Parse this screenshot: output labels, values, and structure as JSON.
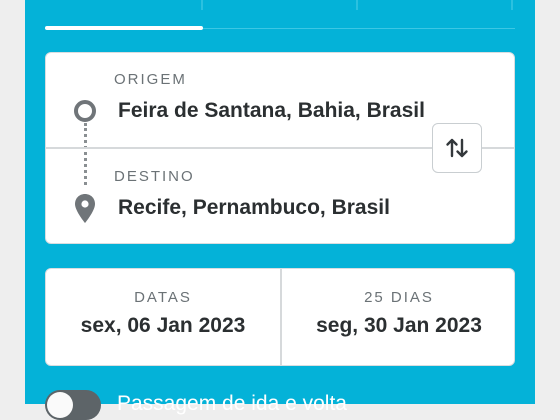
{
  "route": {
    "origin_label": "ORIGEM",
    "origin_value": "Feira de Santana, Bahia, Brasil",
    "destination_label": "DESTINO",
    "destination_value": "Recife, Pernambuco, Brasil"
  },
  "dates": {
    "depart_label": "DATAS",
    "depart_value": "sex, 06 Jan 2023",
    "return_label": "25 DIAS",
    "return_value": "seg, 30 Jan 2023"
  },
  "toggle": {
    "label": "Passagem de ida e volta",
    "on": false
  },
  "colors": {
    "panel": "#04b2d8",
    "card": "#ffffff",
    "text": "#2b2f31"
  },
  "icons": {
    "origin": "circle-icon",
    "destination": "map-pin-icon",
    "swap": "swap-vertical-icon"
  }
}
